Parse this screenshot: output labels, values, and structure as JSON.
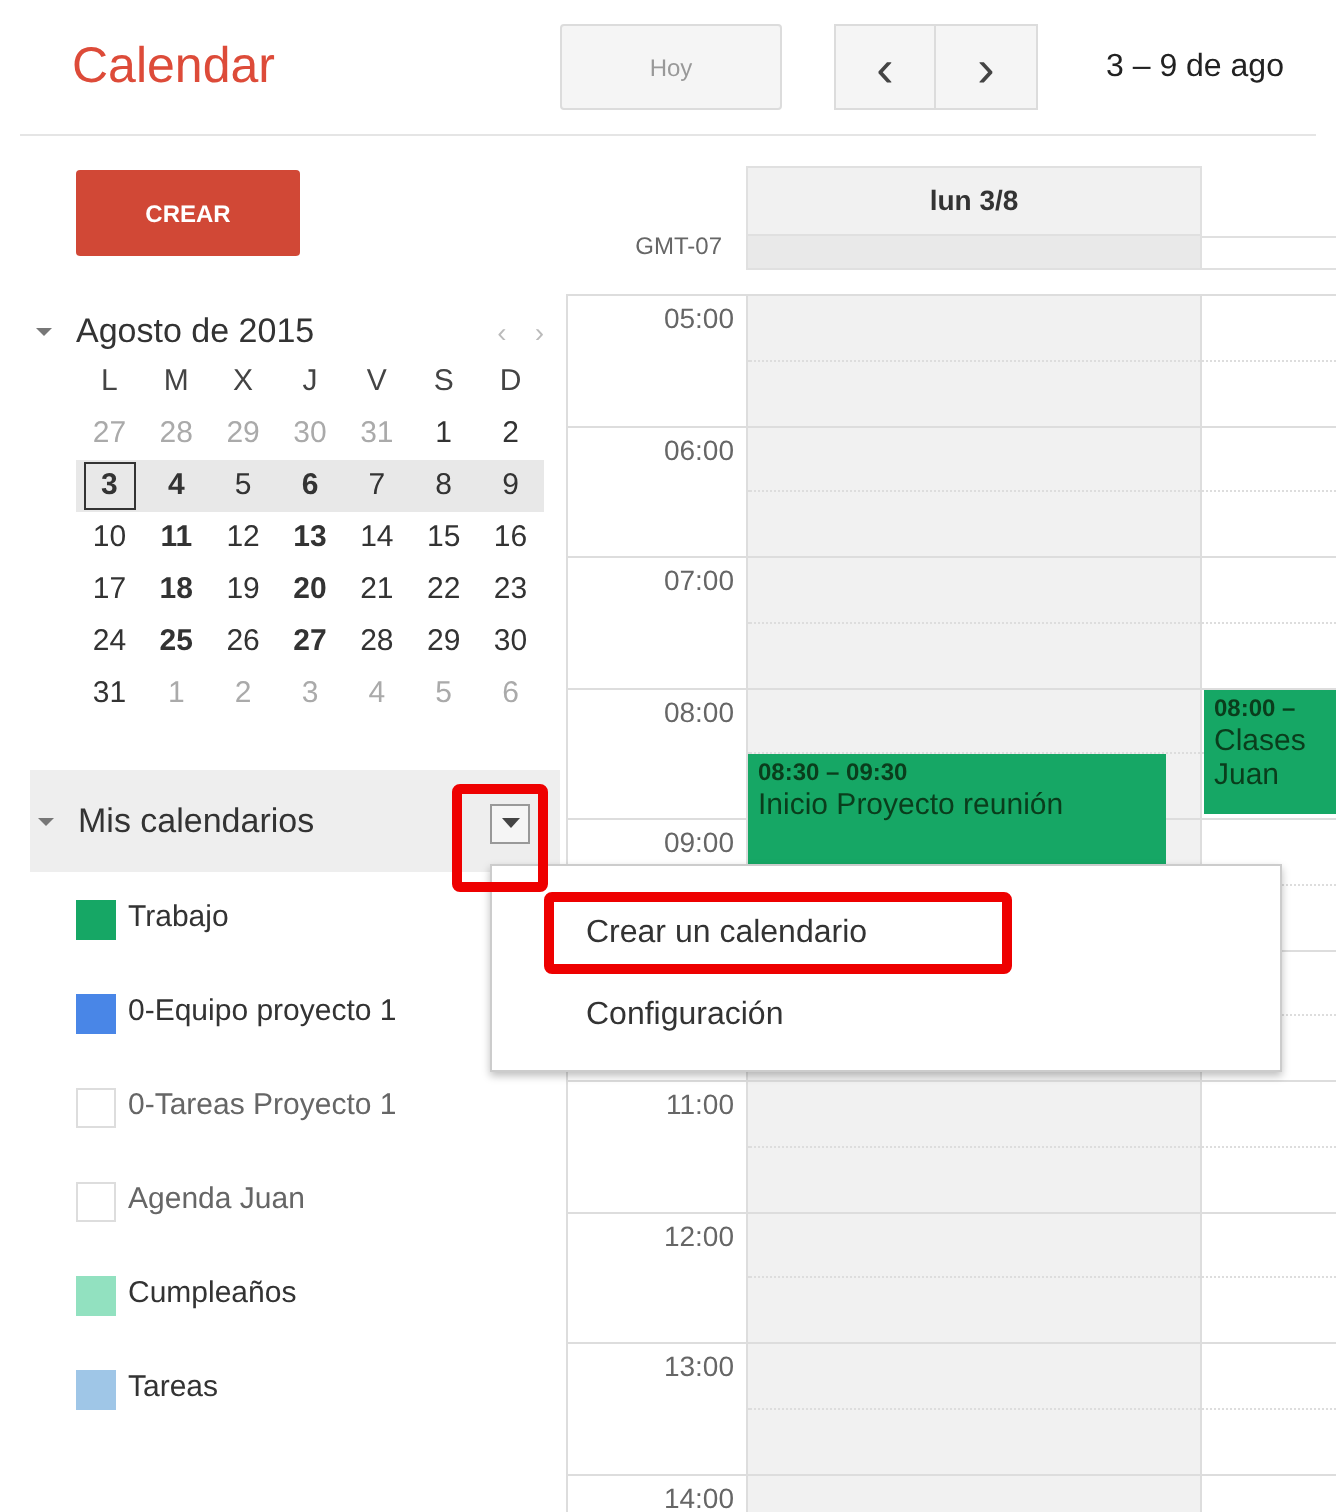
{
  "app_title": "Calendar",
  "toolbar": {
    "today": "Hoy",
    "prev": "‹",
    "next": "›",
    "range": "3 – 9 de ago"
  },
  "create_button": "CREAR",
  "mini_calendar": {
    "title": "Agosto de 2015",
    "prev": "‹",
    "next": "›",
    "weekdays": [
      "L",
      "M",
      "X",
      "J",
      "V",
      "S",
      "D"
    ],
    "weeks": [
      {
        "current": false,
        "days": [
          {
            "d": "27",
            "outside": true,
            "bold": false,
            "selected": false
          },
          {
            "d": "28",
            "outside": true,
            "bold": false,
            "selected": false
          },
          {
            "d": "29",
            "outside": true,
            "bold": false,
            "selected": false
          },
          {
            "d": "30",
            "outside": true,
            "bold": false,
            "selected": false
          },
          {
            "d": "31",
            "outside": true,
            "bold": false,
            "selected": false
          },
          {
            "d": "1",
            "outside": false,
            "bold": false,
            "selected": false
          },
          {
            "d": "2",
            "outside": false,
            "bold": false,
            "selected": false
          }
        ]
      },
      {
        "current": true,
        "days": [
          {
            "d": "3",
            "outside": false,
            "bold": true,
            "selected": true
          },
          {
            "d": "4",
            "outside": false,
            "bold": true,
            "selected": false
          },
          {
            "d": "5",
            "outside": false,
            "bold": false,
            "selected": false
          },
          {
            "d": "6",
            "outside": false,
            "bold": true,
            "selected": false
          },
          {
            "d": "7",
            "outside": false,
            "bold": false,
            "selected": false
          },
          {
            "d": "8",
            "outside": false,
            "bold": false,
            "selected": false
          },
          {
            "d": "9",
            "outside": false,
            "bold": false,
            "selected": false
          }
        ]
      },
      {
        "current": false,
        "days": [
          {
            "d": "10",
            "outside": false,
            "bold": false,
            "selected": false
          },
          {
            "d": "11",
            "outside": false,
            "bold": true,
            "selected": false
          },
          {
            "d": "12",
            "outside": false,
            "bold": false,
            "selected": false
          },
          {
            "d": "13",
            "outside": false,
            "bold": true,
            "selected": false
          },
          {
            "d": "14",
            "outside": false,
            "bold": false,
            "selected": false
          },
          {
            "d": "15",
            "outside": false,
            "bold": false,
            "selected": false
          },
          {
            "d": "16",
            "outside": false,
            "bold": false,
            "selected": false
          }
        ]
      },
      {
        "current": false,
        "days": [
          {
            "d": "17",
            "outside": false,
            "bold": false,
            "selected": false
          },
          {
            "d": "18",
            "outside": false,
            "bold": true,
            "selected": false
          },
          {
            "d": "19",
            "outside": false,
            "bold": false,
            "selected": false
          },
          {
            "d": "20",
            "outside": false,
            "bold": true,
            "selected": false
          },
          {
            "d": "21",
            "outside": false,
            "bold": false,
            "selected": false
          },
          {
            "d": "22",
            "outside": false,
            "bold": false,
            "selected": false
          },
          {
            "d": "23",
            "outside": false,
            "bold": false,
            "selected": false
          }
        ]
      },
      {
        "current": false,
        "days": [
          {
            "d": "24",
            "outside": false,
            "bold": false,
            "selected": false
          },
          {
            "d": "25",
            "outside": false,
            "bold": true,
            "selected": false
          },
          {
            "d": "26",
            "outside": false,
            "bold": false,
            "selected": false
          },
          {
            "d": "27",
            "outside": false,
            "bold": true,
            "selected": false
          },
          {
            "d": "28",
            "outside": false,
            "bold": false,
            "selected": false
          },
          {
            "d": "29",
            "outside": false,
            "bold": false,
            "selected": false
          },
          {
            "d": "30",
            "outside": false,
            "bold": false,
            "selected": false
          }
        ]
      },
      {
        "current": false,
        "days": [
          {
            "d": "31",
            "outside": false,
            "bold": false,
            "selected": false
          },
          {
            "d": "1",
            "outside": true,
            "bold": false,
            "selected": false
          },
          {
            "d": "2",
            "outside": true,
            "bold": false,
            "selected": false
          },
          {
            "d": "3",
            "outside": true,
            "bold": false,
            "selected": false
          },
          {
            "d": "4",
            "outside": true,
            "bold": false,
            "selected": false
          },
          {
            "d": "5",
            "outside": true,
            "bold": false,
            "selected": false
          },
          {
            "d": "6",
            "outside": true,
            "bold": false,
            "selected": false
          }
        ]
      }
    ]
  },
  "my_calendars": {
    "title": "Mis calendarios",
    "expanded": true,
    "items": [
      {
        "label": "Trabajo",
        "checked": true,
        "color": "#16a765"
      },
      {
        "label": "0-Equipo proyecto 1",
        "checked": true,
        "color": "#4986e7"
      },
      {
        "label": "0-Tareas Proyecto 1",
        "checked": false
      },
      {
        "label": "Agenda Juan",
        "checked": false
      },
      {
        "label": "Cumpleaños",
        "checked": true,
        "color": "#92e1c0"
      },
      {
        "label": "Tareas",
        "checked": true,
        "color": "#9fc6e7"
      }
    ]
  },
  "week_view": {
    "timezone": "GMT-07",
    "day_header": "lun 3/8",
    "hours": [
      "05:00",
      "06:00",
      "07:00",
      "08:00",
      "09:00",
      "11:00",
      "12:00",
      "13:00",
      "14:00"
    ],
    "events": [
      {
        "time": "08:30 – 09:30",
        "title": "Inicio Proyecto reunión",
        "color": "#16a765"
      },
      {
        "time": "08:00 –",
        "title": "Clases\nJuan",
        "color": "#16a765"
      }
    ]
  },
  "context_menu": {
    "items": [
      {
        "label": "Crear un calendario",
        "highlighted": true
      },
      {
        "label": "Configuración",
        "highlighted": false
      }
    ]
  }
}
